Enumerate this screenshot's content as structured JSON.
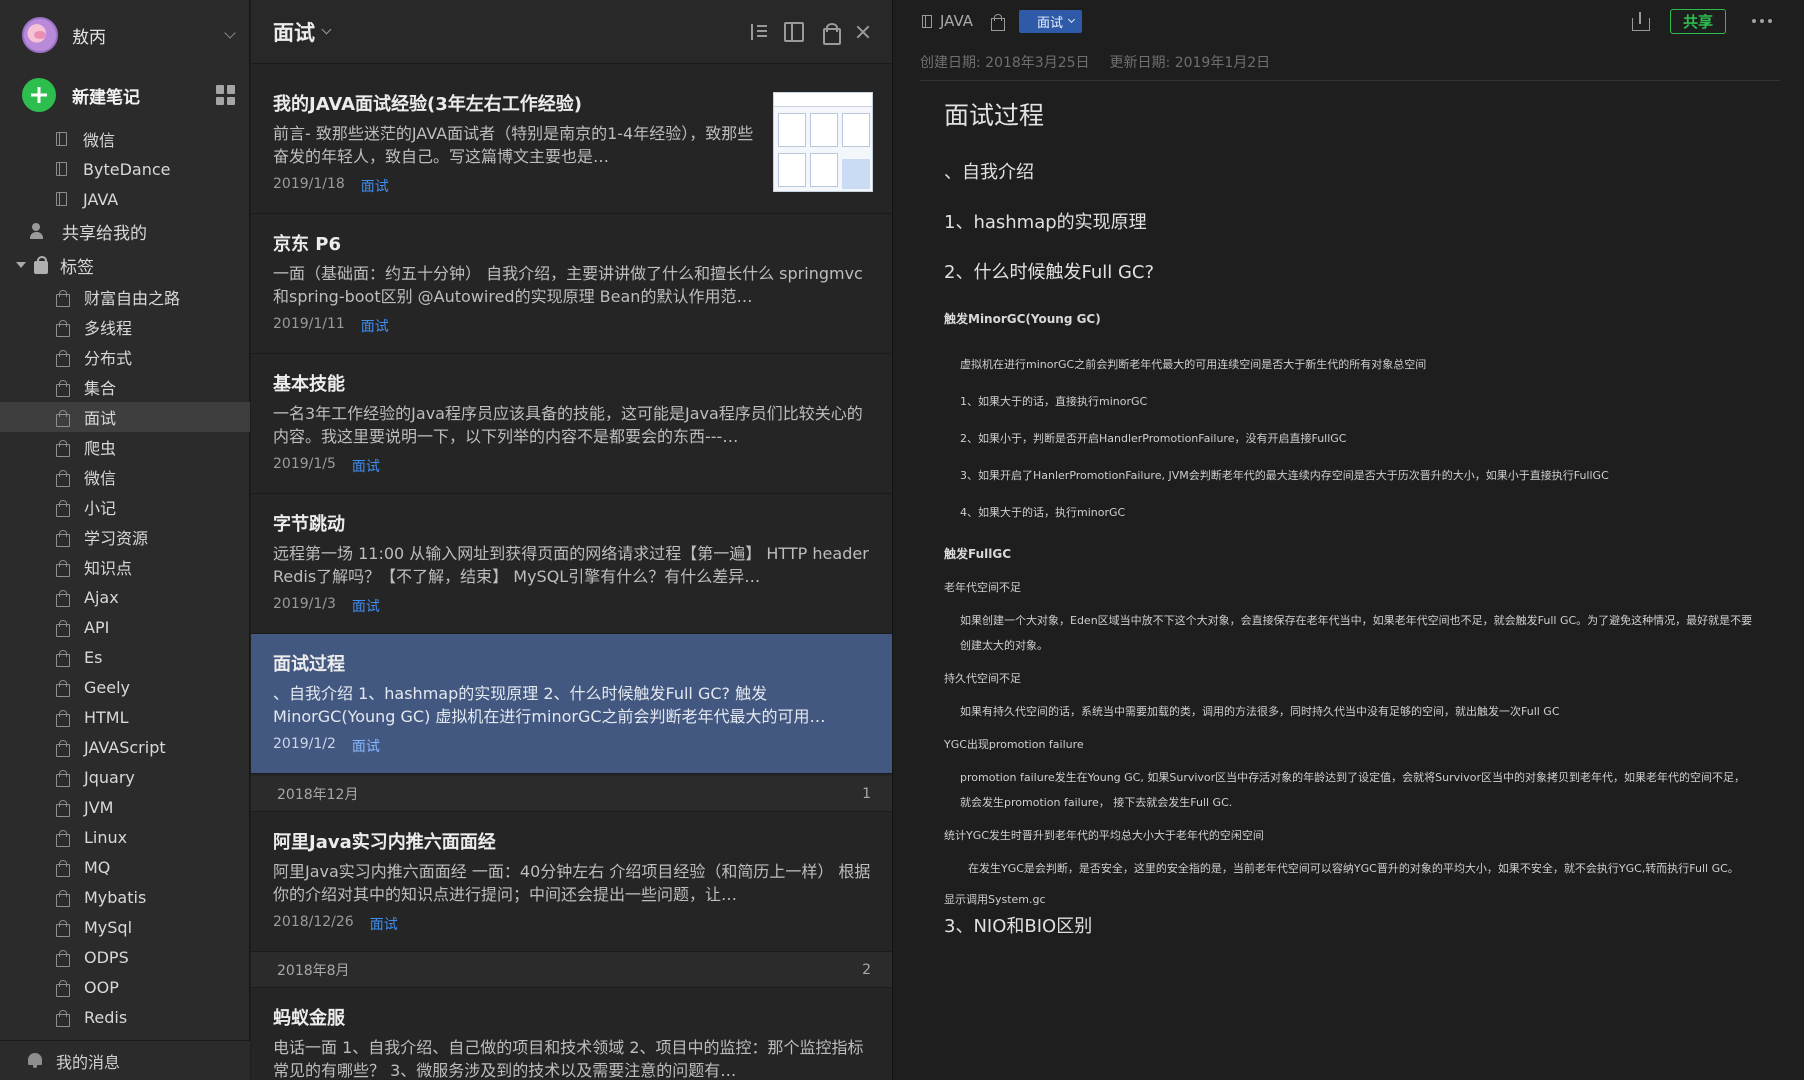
{
  "sidebar": {
    "user": {
      "name": "敖丙"
    },
    "new_note_label": "新建笔记",
    "notebooks": [
      "微信",
      "ByteDance",
      "JAVA"
    ],
    "shared_label": "共享给我的",
    "tags_label": "标签",
    "tags": [
      "财富自由之路",
      "多线程",
      "分布式",
      "集合",
      "面试",
      "爬虫",
      "微信",
      "小记",
      "学习资源",
      "知识点",
      "Ajax",
      "API",
      "Es",
      "Geely",
      "HTML",
      "JAVAScript",
      "Jquary",
      "JVM",
      "Linux",
      "MQ",
      "Mybatis",
      "MySql",
      "ODPS",
      "OOP",
      "Redis"
    ],
    "active_tag": "面试",
    "messages_label": "我的消息"
  },
  "list": {
    "title": "面试",
    "notes": [
      {
        "title": "我的JAVA面试经验(3年左右工作经验)",
        "snippet": "前言- 致那些迷茫的JAVA面试者（特别是南京的1-4年经验），致那些奋发的年轻人，致自己。写这篇博文主要也是…",
        "date": "2019/1/18",
        "tag": "面试"
      },
      {
        "title": "京东 P6",
        "snippet": "一面（基础面：约五十分钟） 自我介绍，主要讲讲做了什么和擅长什么 springmvc和spring-boot区别 @Autowired的实现原理 Bean的默认作用范…",
        "date": "2019/1/11",
        "tag": "面试"
      },
      {
        "title": "基本技能",
        "snippet": "一名3年工作经验的Java程序员应该具备的技能，这可能是Java程序员们比较关心的内容。我这里要说明一下，以下列举的内容不是都要会的东西---…",
        "date": "2019/1/5",
        "tag": "面试"
      },
      {
        "title": "字节跳动",
        "snippet": "远程第一场 11:00 从输入网址到获得页面的网络请求过程【第一遍】 HTTP header Redis了解吗？【不了解，结束】 MySQL引擎有什么？有什么差异…",
        "date": "2019/1/3",
        "tag": "面试"
      },
      {
        "title": "面试过程",
        "snippet": "、自我介绍 1、hashmap的实现原理 2、什么时候触发Full GC? 触发MinorGC(Young GC) 虚拟机在进行minorGC之前会判断老年代最大的可用…",
        "date": "2019/1/2",
        "tag": "面试"
      }
    ],
    "month_dec": {
      "label": "2018年12月",
      "count": "1"
    },
    "note_dec": {
      "title": "阿里Java实习内推六面面经",
      "snippet": "阿里Java实习内推六面面经 一面：40分钟左右 介绍项目经验（和简历上一样） 根据你的介绍对其中的知识点进行提问；中间还会提出一些问题，让…",
      "date": "2018/12/26",
      "tag": "面试"
    },
    "month_aug": {
      "label": "2018年8月",
      "count": "2"
    },
    "note_aug": {
      "title": "蚂蚁金服",
      "snippet": "电话一面 1、自我介绍、自己做的项目和技术领域 2、项目中的监控：那个监控指标常见的有哪些？ 3、微服务涉及到的技术以及需要注意的问题有…"
    }
  },
  "editor": {
    "notebook": "JAVA",
    "tag": "面试",
    "share_label": "共享",
    "created": "创建日期: 2018年3月25日",
    "updated": "更新日期: 2019年1月2日",
    "doc_title": "面试过程",
    "h_intro": "、自我介绍",
    "h_hashmap": "1、hashmap的实现原理",
    "h_fullgc": "2、什么时候触发Full GC?",
    "minor_title": "触发MinorGC(Young GC)",
    "minor_intro": "虚拟机在进行minorGC之前会判断老年代最大的可用连续空间是否大于新生代的所有对象总空间",
    "minor_1": "1、如果大于的话，直接执行minorGC",
    "minor_2": "2、如果小于，判断是否开启HandlerPromotionFailure，没有开启直接FullGC",
    "minor_3": "3、如果开启了HanlerPromotionFailure, JVM会判断老年代的最大连续内存空间是否大于历次晋升的大小，如果小于直接执行FullGC",
    "minor_4": "4、如果大于的话，执行minorGC",
    "full_title": "触发FullGC",
    "old_gen": "老年代空间不足",
    "old_gen_text": "如果创建一个大对象，Eden区域当中放不下这个大对象，会直接保存在老年代当中，如果老年代空间也不足，就会触发Full GC。为了避免这种情况，最好就是不要创建太大的对象。",
    "perm_gen": "持久代空间不足",
    "perm_gen_text": "如果有持久代空间的话，系统当中需要加载的类，调用的方法很多，同时持久代当中没有足够的空间，就出触发一次Full GC",
    "ygc_pf": "YGC出现promotion failure",
    "ygc_pf_text": "promotion failure发生在Young GC, 如果Survivor区当中存活对象的年龄达到了设定值，会就将Survivor区当中的对象拷贝到老年代，如果老年代的空间不足，就会发生promotion failure， 接下去就会发生Full GC.",
    "ygc_avg": "统计YGC发生时晋升到老年代的平均总大小大于老年代的空闲空间",
    "ygc_avg_text": "在发生YGC是会判断，是否安全，这里的安全指的是，当前老年代空间可以容纳YGC晋升的对象的平均大小，如果不安全，就不会执行YGC,转而执行Full GC。",
    "system_gc": "显示调用System.gc",
    "h_nio": "3、NIO和BIO区别"
  }
}
